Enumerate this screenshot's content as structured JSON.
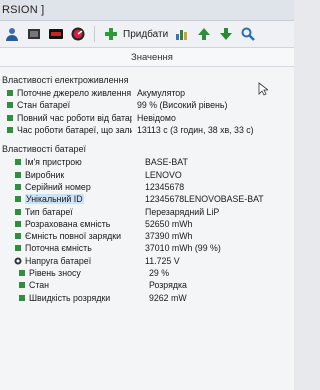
{
  "window": {
    "title_fragment": "RSION ]"
  },
  "toolbar": {
    "add_label": "Придбати",
    "icons": [
      "user-icon",
      "memory-icon",
      "osd-icon",
      "speedometer-icon",
      "add-icon",
      "chart-icon",
      "arrow-up-icon",
      "arrow-down-icon",
      "search-icon"
    ]
  },
  "columns": {
    "field": "",
    "value": "Значення"
  },
  "sections": [
    {
      "title": "Властивості електроживлення",
      "rows": [
        {
          "name": "Поточне джерело живлення",
          "value": "Акумулятор"
        },
        {
          "name": "Стан батареї",
          "value": "99 % (Високий рівень)"
        },
        {
          "name": "Повний час роботи від батареї",
          "value": "Невідомо"
        },
        {
          "name": "Час роботи батареї, що залиш...",
          "value": "13113 с (3 годин, 38 хв, 33 с)"
        }
      ]
    },
    {
      "title": "Властивості батареї",
      "rows": [
        {
          "name": "Ім'я пристрою",
          "value": "BASE-BAT"
        },
        {
          "name": "Виробник",
          "value": "LENOVO"
        },
        {
          "name": "Серійний номер",
          "value": "12345678"
        },
        {
          "name": "Унікальний ID",
          "value": "12345678LENOVOBASE-BAT"
        },
        {
          "name": "Тип батареї",
          "value": "Перезарядний LiP"
        },
        {
          "name": "Розрахована ємність",
          "value": "52650 mWh"
        },
        {
          "name": "Ємність повної зарядки",
          "value": "37390 mWh"
        },
        {
          "name": "Поточна ємність",
          "value": "37010 mWh (99 %)"
        },
        {
          "name": "Напруга батареї",
          "value": "11.725 V"
        },
        {
          "name": "Рівень зносу",
          "value": "29 %"
        },
        {
          "name": "Стан",
          "value": "Розрядка"
        },
        {
          "name": "Швидкість розрядки",
          "value": "9262 mW"
        }
      ]
    }
  ],
  "colors": {
    "selection": "#cbe2fb",
    "icon_green": "#3f9a3a",
    "arrow_up": "#2f8f3c",
    "arrow_down": "#2a8b34"
  }
}
